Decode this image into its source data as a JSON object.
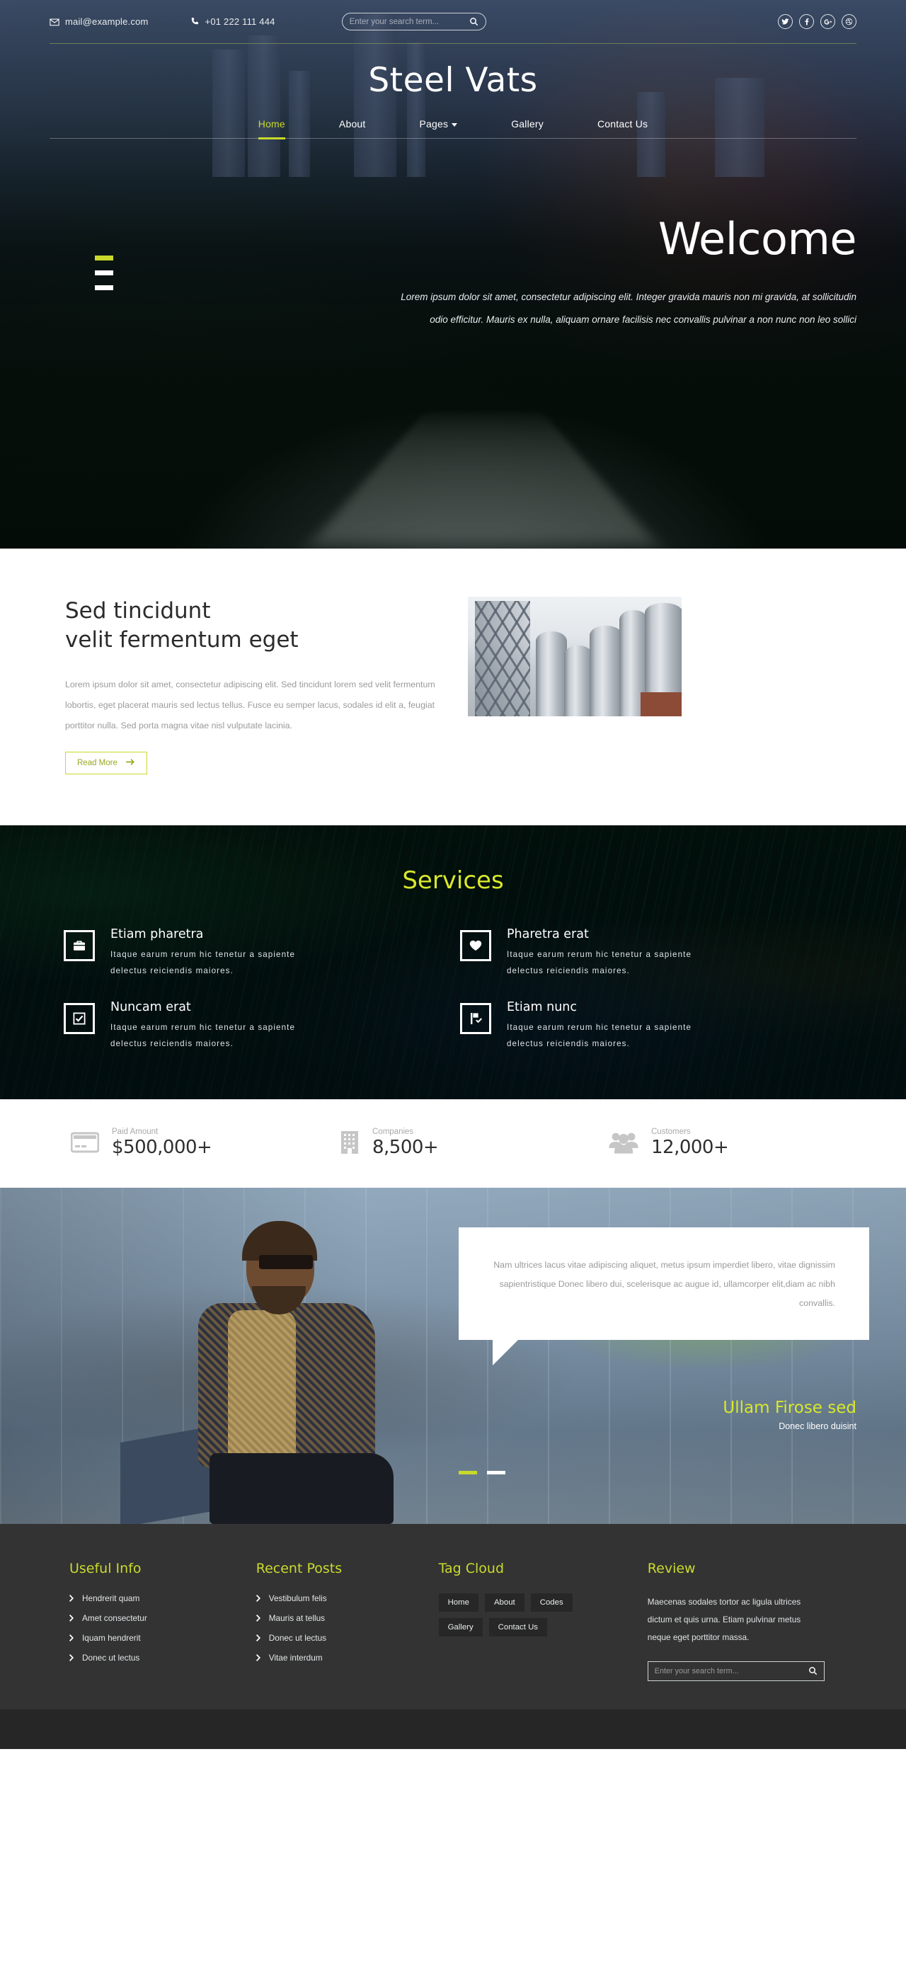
{
  "theme": {
    "accent": "#c9d92b",
    "accent_bright": "#d8e82b",
    "footer_bg": "#333333",
    "footer_bottom_bg": "#262626",
    "text_muted": "#9b9b9b"
  },
  "topbar": {
    "email": "mail@example.com",
    "email_icon": "envelope-icon",
    "phone": "+01 222 111 444",
    "phone_icon": "phone-icon",
    "search_placeholder": "Enter your search term...",
    "search_value": "",
    "search_icon": "search-icon",
    "socials": [
      {
        "name": "twitter",
        "icon": "twitter-icon"
      },
      {
        "name": "facebook",
        "icon": "facebook-icon"
      },
      {
        "name": "google-plus",
        "icon": "google-plus-icon"
      },
      {
        "name": "dribbble",
        "icon": "dribbble-icon"
      }
    ]
  },
  "brand": {
    "title": "Steel Vats"
  },
  "nav": {
    "items": [
      {
        "label": "Home",
        "active": true,
        "has_dropdown": false
      },
      {
        "label": "About",
        "active": false,
        "has_dropdown": false
      },
      {
        "label": "Pages",
        "active": false,
        "has_dropdown": true
      },
      {
        "label": "Gallery",
        "active": false,
        "has_dropdown": false
      },
      {
        "label": "Contact Us",
        "active": false,
        "has_dropdown": false
      }
    ]
  },
  "hero": {
    "title": "Welcome",
    "subtitle": "Lorem ipsum dolor sit amet, consectetur adipiscing elit. Integer gravida mauris non mi gravida, at sollicitudin odio efficitur. Mauris ex nulla, aliquam ornare facilisis nec convallis pulvinar a non nunc non leo sollici",
    "slide_count": 3,
    "active_slide": 1
  },
  "about": {
    "heading_line1": "Sed tincidunt",
    "heading_line2": "velit fermentum eget",
    "body": "Lorem ipsum dolor sit amet, consectetur adipiscing elit. Sed tincidunt lorem sed velit fermentum lobortis, eget placerat mauris sed lectus tellus. Fusce eu semper lacus, sodales id elit a, feugiat porttitor nulla. Sed porta magna vitae nisl vulputate lacinia.",
    "button_label": "Read More",
    "button_icon": "arrow-right-icon",
    "image_alt": "steel-silos-photo"
  },
  "services": {
    "title": "Services",
    "items": [
      {
        "icon": "briefcase-icon",
        "title": "Etiam pharetra",
        "text": "Itaque earum rerum hic tenetur a sapiente delectus reiciendis maiores."
      },
      {
        "icon": "heart-icon",
        "title": "Pharetra erat",
        "text": "Itaque earum rerum hic tenetur a sapiente delectus reiciendis maiores."
      },
      {
        "icon": "check-square-icon",
        "title": "Nuncam erat",
        "text": "Itaque earum rerum hic tenetur a sapiente delectus reiciendis maiores."
      },
      {
        "icon": "flag-check-icon",
        "title": "Etiam nunc",
        "text": "Itaque earum rerum hic tenetur a sapiente delectus reiciendis maiores."
      }
    ]
  },
  "stats": {
    "items": [
      {
        "icon": "credit-card-icon",
        "label": "Paid Amount",
        "value": "$500,000+"
      },
      {
        "icon": "building-icon",
        "label": "Companies",
        "value": "8,500+"
      },
      {
        "icon": "users-icon",
        "label": "Customers",
        "value": "12,000+"
      }
    ]
  },
  "testimonial": {
    "quote": "Nam ultrices lacus vitae adipiscing aliquet, metus ipsum imperdiet libero, vitae dignissim sapientristique Donec libero dui, scelerisque ac augue id, ullamcorper elit,diam ac nibh convallis.",
    "name": "Ullam Firose sed",
    "role": "Donec libero duisint",
    "slide_count": 2,
    "active_slide": 1,
    "image_alt": "man-sitting-with-sunglasses-photo"
  },
  "footer": {
    "useful_info": {
      "title": "Useful Info",
      "links": [
        "Hendrerit quam",
        "Amet consectetur",
        "Iquam hendrerit",
        "Donec ut lectus"
      ]
    },
    "recent_posts": {
      "title": "Recent Posts",
      "links": [
        "Vestibulum felis",
        "Mauris at tellus",
        "Donec ut lectus",
        "Vitae interdum"
      ]
    },
    "tag_cloud": {
      "title": "Tag Cloud",
      "tags": [
        "Home",
        "About",
        "Codes",
        "Gallery",
        "Contact Us"
      ]
    },
    "review": {
      "title": "Review",
      "text": "Maecenas sodales tortor ac ligula ultrices dictum et quis urna. Etiam pulvinar metus neque eget porttitor massa.",
      "search_placeholder": "Enter your search term...",
      "search_value": "",
      "search_icon": "search-icon"
    }
  }
}
